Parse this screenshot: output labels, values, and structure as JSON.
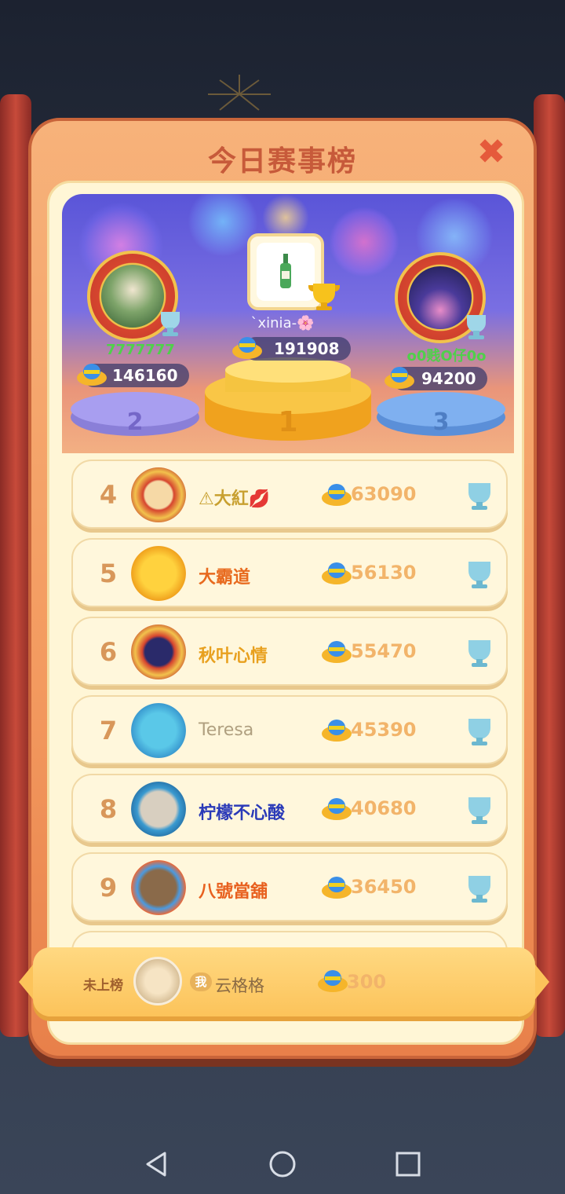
{
  "window": {
    "title": "今日赛事榜",
    "close_label": "✖"
  },
  "podium": {
    "first": {
      "rank": "1",
      "name": "`xinia-🌸",
      "score": "191908"
    },
    "second": {
      "rank": "2",
      "name": "7777777",
      "score": "146160"
    },
    "third": {
      "rank": "3",
      "name": "o0贱O仔0o",
      "score": "94200"
    }
  },
  "leaderboard": [
    {
      "rank": "4",
      "name": "⚠大紅💋",
      "score": "63090",
      "name_color": "#c8a030"
    },
    {
      "rank": "5",
      "name": "大霸道",
      "score": "56130",
      "name_color": "#e86a1e"
    },
    {
      "rank": "6",
      "name": "秋叶心情",
      "score": "55470",
      "name_color": "#e8a01e"
    },
    {
      "rank": "7",
      "name": "Teresa",
      "score": "45390",
      "name_color": "#b0a080"
    },
    {
      "rank": "8",
      "name": "柠檬不心酸",
      "score": "40680",
      "name_color": "#2a3ab8"
    },
    {
      "rank": "9",
      "name": "八號當舖",
      "score": "36450",
      "name_color": "#e8601e"
    }
  ],
  "my_entry": {
    "status": "未上榜",
    "me_tag": "我",
    "name": "云格格",
    "score": "300"
  },
  "navigation": {
    "back_icon": "back-icon",
    "home_icon": "home-icon",
    "recents_icon": "recents-icon"
  },
  "colors": {
    "accent": "#f39a5f",
    "title": "#c75a3a",
    "score": "#f2b46a"
  }
}
